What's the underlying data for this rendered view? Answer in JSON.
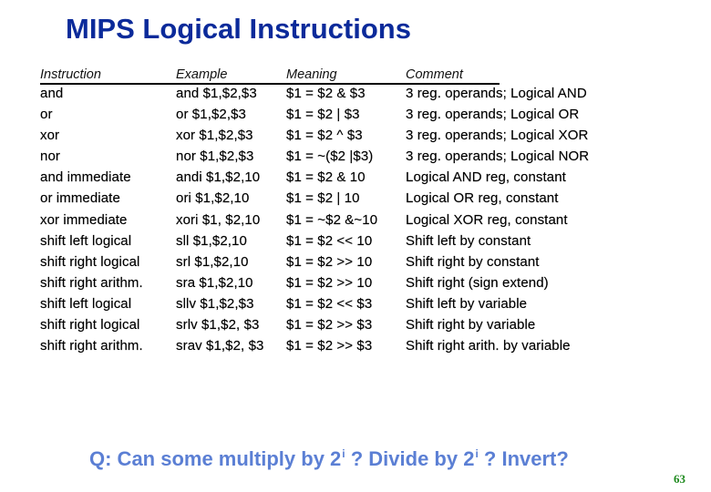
{
  "slide": {
    "title": "MIPS Logical Instructions",
    "headers": [
      "Instruction",
      "Example",
      "Meaning",
      "Comment"
    ],
    "rows": [
      {
        "instruction": "and",
        "example": "and $1,$2,$3",
        "meaning": "$1 = $2 & $3",
        "comment": "3 reg. operands; Logical AND"
      },
      {
        "instruction": "or",
        "example": "or $1,$2,$3",
        "meaning": "$1 = $2 | $3",
        "comment": "3 reg. operands; Logical OR"
      },
      {
        "instruction": "xor",
        "example": "xor $1,$2,$3",
        "meaning": "$1 = $2 ^ $3",
        "comment": "3 reg. operands; Logical XOR"
      },
      {
        "instruction": "nor",
        "example": "nor $1,$2,$3",
        "meaning": "$1 = ~($2 |$3)",
        "comment": "3 reg. operands; Logical NOR"
      },
      {
        "instruction": "and immediate",
        "example": "andi $1,$2,10",
        "meaning": "$1 = $2 & 10",
        "comment": "Logical AND reg, constant"
      },
      {
        "instruction": "or immediate",
        "example": "ori $1,$2,10",
        "meaning": "$1 = $2 | 10",
        "comment": "Logical OR reg, constant"
      },
      {
        "instruction": "xor immediate",
        "example": "xori $1, $2,10",
        "meaning": "$1 = ~$2 &~10",
        "comment": "Logical XOR reg, constant"
      },
      {
        "instruction": "shift left logical",
        "example": "sll $1,$2,10",
        "meaning": "$1 = $2 << 10",
        "comment": "Shift left by constant"
      },
      {
        "instruction": "shift right logical",
        "example": "srl $1,$2,10",
        "meaning": "$1 = $2 >> 10",
        "comment": "Shift right by constant"
      },
      {
        "instruction": "shift right arithm.",
        "example": "sra $1,$2,10",
        "meaning": "$1 = $2 >> 10",
        "comment": "Shift right (sign extend)"
      },
      {
        "instruction": "shift left logical",
        "example": "sllv $1,$2,$3",
        "meaning": "$1 = $2 << $3",
        "comment": "Shift left by variable"
      },
      {
        "instruction": "shift right logical",
        "example": "srlv $1,$2, $3",
        "meaning": "$1 = $2 >> $3",
        "comment": "Shift right by variable"
      },
      {
        "instruction": "shift right arithm.",
        "example": "srav $1,$2, $3",
        "meaning": "$1 = $2 >> $3",
        "comment": "Shift right arith. by variable"
      }
    ],
    "question": {
      "part1": "Q: Can some multiply by 2",
      "sup1": "i",
      "part2": " ? Divide by 2",
      "sup2": "i",
      "part3": " ? Invert?"
    },
    "page_number": "63",
    "colors": {
      "title": "#0b2a9a",
      "question": "#5b7fd4",
      "page_number": "#1e8a1e"
    }
  }
}
